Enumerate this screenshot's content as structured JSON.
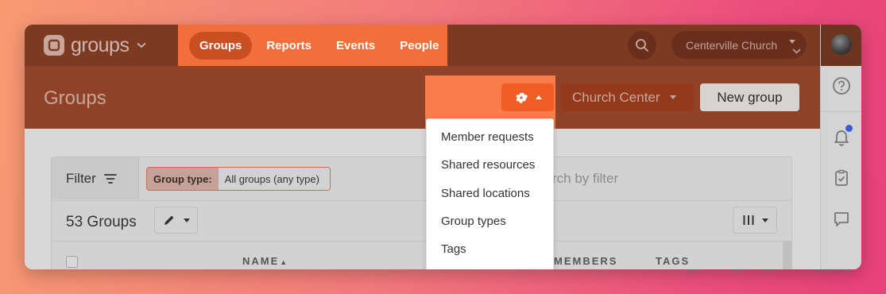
{
  "app": {
    "name": "groups"
  },
  "nav": {
    "tabs": [
      {
        "label": "Groups",
        "active": true
      },
      {
        "label": "Reports",
        "active": false
      },
      {
        "label": "Events",
        "active": false
      },
      {
        "label": "People",
        "active": false
      }
    ],
    "organization": "Centerville Church"
  },
  "header": {
    "title": "Groups",
    "church_center_label": "Church Center",
    "new_group_label": "New group"
  },
  "settings_menu": {
    "items": [
      "Member requests",
      "Shared resources",
      "Shared locations",
      "Group types",
      "Tags"
    ]
  },
  "filter": {
    "label": "Filter",
    "chip_key": "Group type:",
    "chip_value": "All groups (any type)",
    "search_placeholder": "rch by filter"
  },
  "list": {
    "count_label": "53 Groups",
    "columns": [
      "NAME",
      "MEMBERS",
      "TAGS"
    ]
  },
  "rail": {
    "icons": [
      "help-icon",
      "bell-icon",
      "clipboard-check-icon",
      "chat-icon"
    ],
    "notification_color": "#3b5bd6"
  },
  "colors": {
    "brand": "#f26f3c",
    "nav_bg": "#7d3a23"
  }
}
